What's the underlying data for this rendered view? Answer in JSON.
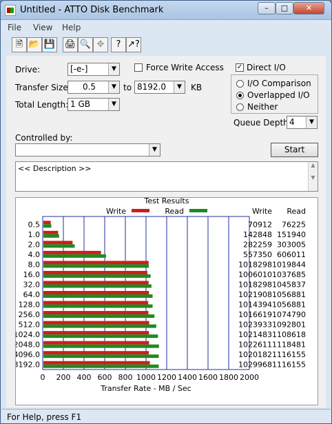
{
  "window": {
    "title": "Untitled - ATTO Disk Benchmark"
  },
  "menu": [
    "File",
    "View",
    "Help"
  ],
  "toolbar": {
    "icons": [
      "new-icon",
      "open-icon",
      "save-icon",
      "print-icon",
      "print-preview-icon",
      "move-icon",
      "help-icon",
      "context-help-icon"
    ]
  },
  "form": {
    "drive_label": "Drive:",
    "drive_value": "[-e-]",
    "force_write_label": "Force Write Access",
    "force_write_checked": false,
    "direct_io_label": "Direct I/O",
    "direct_io_checked": true,
    "transfer_size_label": "Transfer Size:",
    "transfer_from": "0.5",
    "to_label": "to",
    "transfer_to": "8192.0",
    "kb_label": "KB",
    "total_length_label": "Total Length:",
    "total_length_value": "1 GB",
    "io_options": [
      "I/O Comparison",
      "Overlapped I/O",
      "Neither"
    ],
    "io_selected": "Overlapped I/O",
    "queue_depth_label": "Queue Depth:",
    "queue_depth_value": "4",
    "controlled_by_label": "Controlled by:",
    "controlled_by_value": "",
    "start_label": "Start",
    "description_text": "<< Description >>"
  },
  "results": {
    "title": "Test Results",
    "write_legend": "Write",
    "read_legend": "Read",
    "write_col": "Write",
    "read_col": "Read",
    "rows": [
      {
        "size": "0.5",
        "write": "70912",
        "read": "76225"
      },
      {
        "size": "1.0",
        "write": "142848",
        "read": "151940"
      },
      {
        "size": "2.0",
        "write": "282259",
        "read": "303005"
      },
      {
        "size": "4.0",
        "write": "557350",
        "read": "606011"
      },
      {
        "size": "8.0",
        "write": "1018298",
        "read": "1019844"
      },
      {
        "size": "16.0",
        "write": "1006010",
        "read": "1037685"
      },
      {
        "size": "32.0",
        "write": "1018298",
        "read": "1045837"
      },
      {
        "size": "64.0",
        "write": "1021908",
        "read": "1056881"
      },
      {
        "size": "128.0",
        "write": "1014394",
        "read": "1056881"
      },
      {
        "size": "256.0",
        "write": "1016619",
        "read": "1074790"
      },
      {
        "size": "512.0",
        "write": "1023933",
        "read": "1092801"
      },
      {
        "size": "1024.0",
        "write": "1021483",
        "read": "1108618"
      },
      {
        "size": "2048.0",
        "write": "1022611",
        "read": "1118481"
      },
      {
        "size": "4096.0",
        "write": "1020182",
        "read": "1116155"
      },
      {
        "size": "8192.0",
        "write": "1029968",
        "read": "1116155"
      }
    ],
    "x_ticks": [
      "0",
      "200",
      "400",
      "600",
      "800",
      "1000",
      "1200",
      "1400",
      "1600",
      "1800",
      "2000"
    ],
    "x_label": "Transfer Rate - MB / Sec",
    "colors": {
      "write": "#cc1f1a",
      "read": "#1f8a1f",
      "grid": "#1f2f9a"
    }
  },
  "chart_data": {
    "type": "bar",
    "title": "Test Results",
    "categories": [
      "0.5",
      "1.0",
      "2.0",
      "4.0",
      "8.0",
      "16.0",
      "32.0",
      "64.0",
      "128.0",
      "256.0",
      "512.0",
      "1024.0",
      "2048.0",
      "4096.0",
      "8192.0"
    ],
    "series": [
      {
        "name": "Write",
        "values": [
          70.9,
          142.8,
          282.3,
          557.4,
          1018.3,
          1006.0,
          1018.3,
          1021.9,
          1014.4,
          1016.6,
          1023.9,
          1021.5,
          1022.6,
          1020.2,
          1030.0
        ]
      },
      {
        "name": "Read",
        "values": [
          76.2,
          151.9,
          303.0,
          606.0,
          1019.8,
          1037.7,
          1045.8,
          1056.9,
          1056.9,
          1074.8,
          1092.8,
          1108.6,
          1118.5,
          1116.2,
          1116.2
        ]
      }
    ],
    "xlabel": "Transfer Rate - MB / Sec",
    "xlim": [
      0,
      2000
    ],
    "orientation": "horizontal"
  },
  "status": {
    "text": "For Help, press F1"
  }
}
